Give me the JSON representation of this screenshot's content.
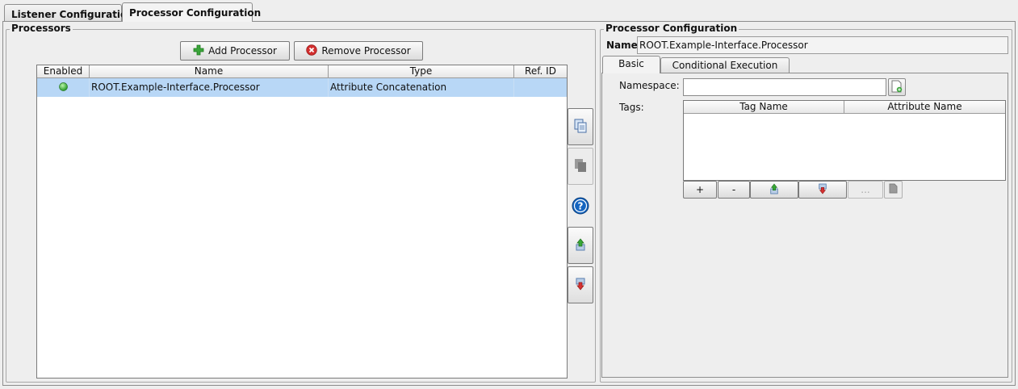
{
  "tabs": [
    {
      "label": "Listener Configuration",
      "active": false
    },
    {
      "label": "Processor Configuration",
      "active": true
    }
  ],
  "processors": {
    "title": "Processors",
    "add_label": "Add Processor",
    "remove_label": "Remove Processor",
    "columns": [
      "Enabled",
      "Name",
      "Type",
      "Ref. ID"
    ],
    "rows": [
      {
        "enabled": true,
        "name": "ROOT.Example-Interface.Processor",
        "type": "Attribute Concatenation",
        "ref_id": ""
      }
    ]
  },
  "side_buttons": [
    {
      "icon": "copy-icon",
      "enabled": true
    },
    {
      "icon": "paste-icon",
      "enabled": false
    },
    {
      "icon": "help-icon",
      "enabled": true
    },
    {
      "icon": "move-up-icon",
      "enabled": true
    },
    {
      "icon": "move-down-icon",
      "enabled": true
    }
  ],
  "config": {
    "title": "Processor Configuration",
    "name_label": "Name:",
    "name_value": "ROOT.Example-Interface.Processor",
    "subtabs": [
      {
        "label": "Basic",
        "active": true
      },
      {
        "label": "Conditional Execution",
        "active": false
      }
    ],
    "namespace_label": "Namespace:",
    "namespace_value": "",
    "tags_label": "Tags:",
    "tags_columns": [
      "Tag Name",
      "Attribute Name"
    ],
    "tag_buttons": {
      "add": "+",
      "remove": "-",
      "ellipsis": "..."
    }
  },
  "colors": {
    "selection": "#b8d7f6",
    "enabled_dot": "#3cb043",
    "help": "#1565c0",
    "add_green": "#3aa53a",
    "remove_red": "#d32f2f"
  }
}
